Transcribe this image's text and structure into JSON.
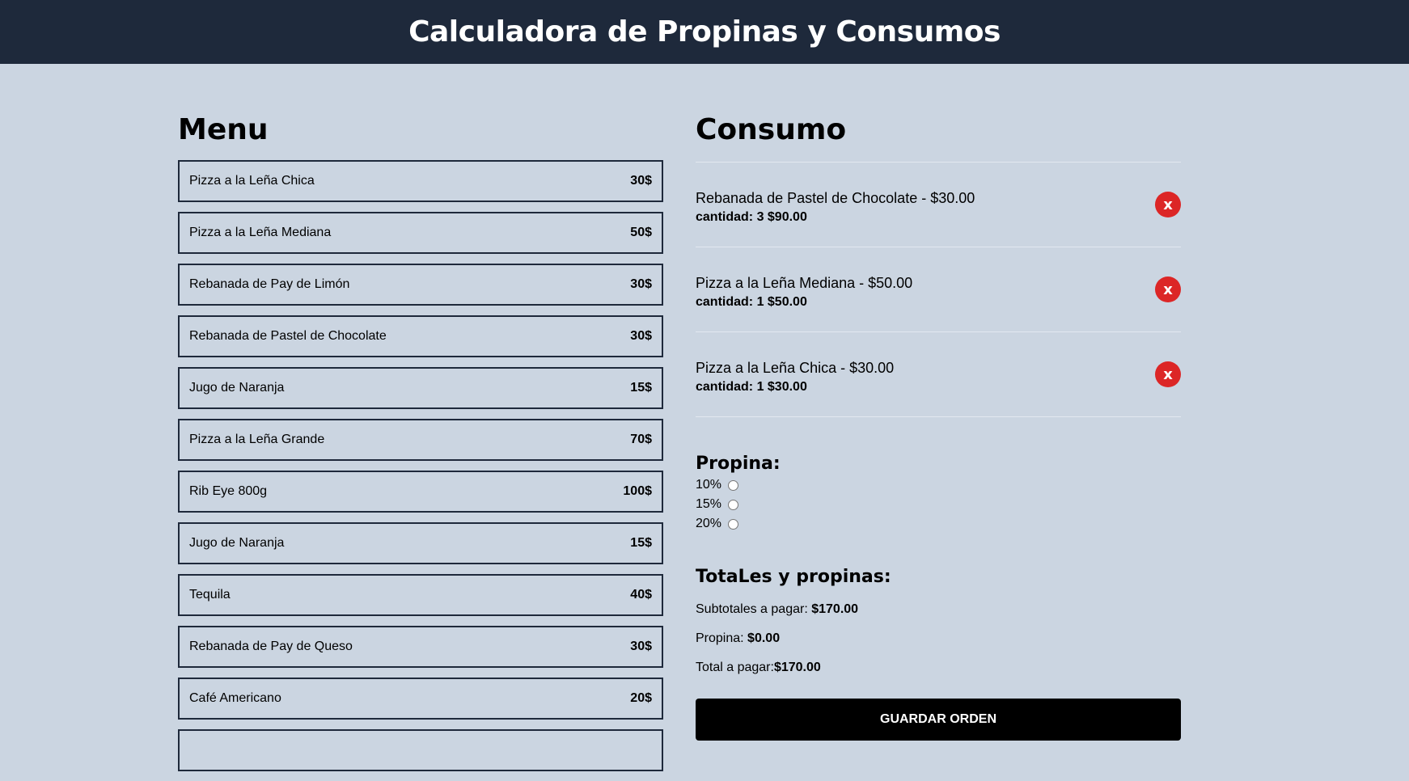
{
  "header": {
    "title": "Calculadora de Propinas y Consumos"
  },
  "menu": {
    "title": "Menu",
    "items": [
      {
        "name": "Pizza a la Leña Chica",
        "price": "30$"
      },
      {
        "name": "Pizza a la Leña Mediana",
        "price": "50$"
      },
      {
        "name": "Rebanada de Pay de Limón",
        "price": "30$"
      },
      {
        "name": "Rebanada de Pastel de Chocolate",
        "price": "30$"
      },
      {
        "name": "Jugo de Naranja",
        "price": "15$"
      },
      {
        "name": "Pizza a la Leña Grande",
        "price": "70$"
      },
      {
        "name": "Rib Eye 800g",
        "price": "100$"
      },
      {
        "name": "Jugo de Naranja",
        "price": "15$"
      },
      {
        "name": "Tequila",
        "price": "40$"
      },
      {
        "name": "Rebanada de Pay de Queso",
        "price": "30$"
      },
      {
        "name": "Café Americano",
        "price": "20$"
      }
    ]
  },
  "consumo": {
    "title": "Consumo",
    "orders": [
      {
        "line": "Rebanada de Pastel de Chocolate - $30.00",
        "qty": "cantidad: 3 $90.00",
        "remove": "x"
      },
      {
        "line": "Pizza a la Leña Mediana - $50.00",
        "qty": "cantidad: 1 $50.00",
        "remove": "x"
      },
      {
        "line": "Pizza a la Leña Chica - $30.00",
        "qty": "cantidad: 1 $30.00",
        "remove": "x"
      }
    ]
  },
  "tips": {
    "title": "Propina:",
    "options": [
      {
        "label": "10%",
        "checked": false
      },
      {
        "label": "15%",
        "checked": false
      },
      {
        "label": "20%",
        "checked": false
      }
    ]
  },
  "totals": {
    "title": "TotaLes y propinas:",
    "subtotal_label": "Subtotales a pagar: ",
    "subtotal_value": "$170.00",
    "tip_label": "Propina: ",
    "tip_value": "$0.00",
    "total_label": "Total a pagar:",
    "total_value": "$170.00"
  },
  "save_button": {
    "label": "GUARDAR ORDEN"
  },
  "colors": {
    "header_bg": "#1e293b",
    "page_bg": "#cbd5e1",
    "remove_btn": "#dc2626",
    "save_btn": "#000000"
  }
}
